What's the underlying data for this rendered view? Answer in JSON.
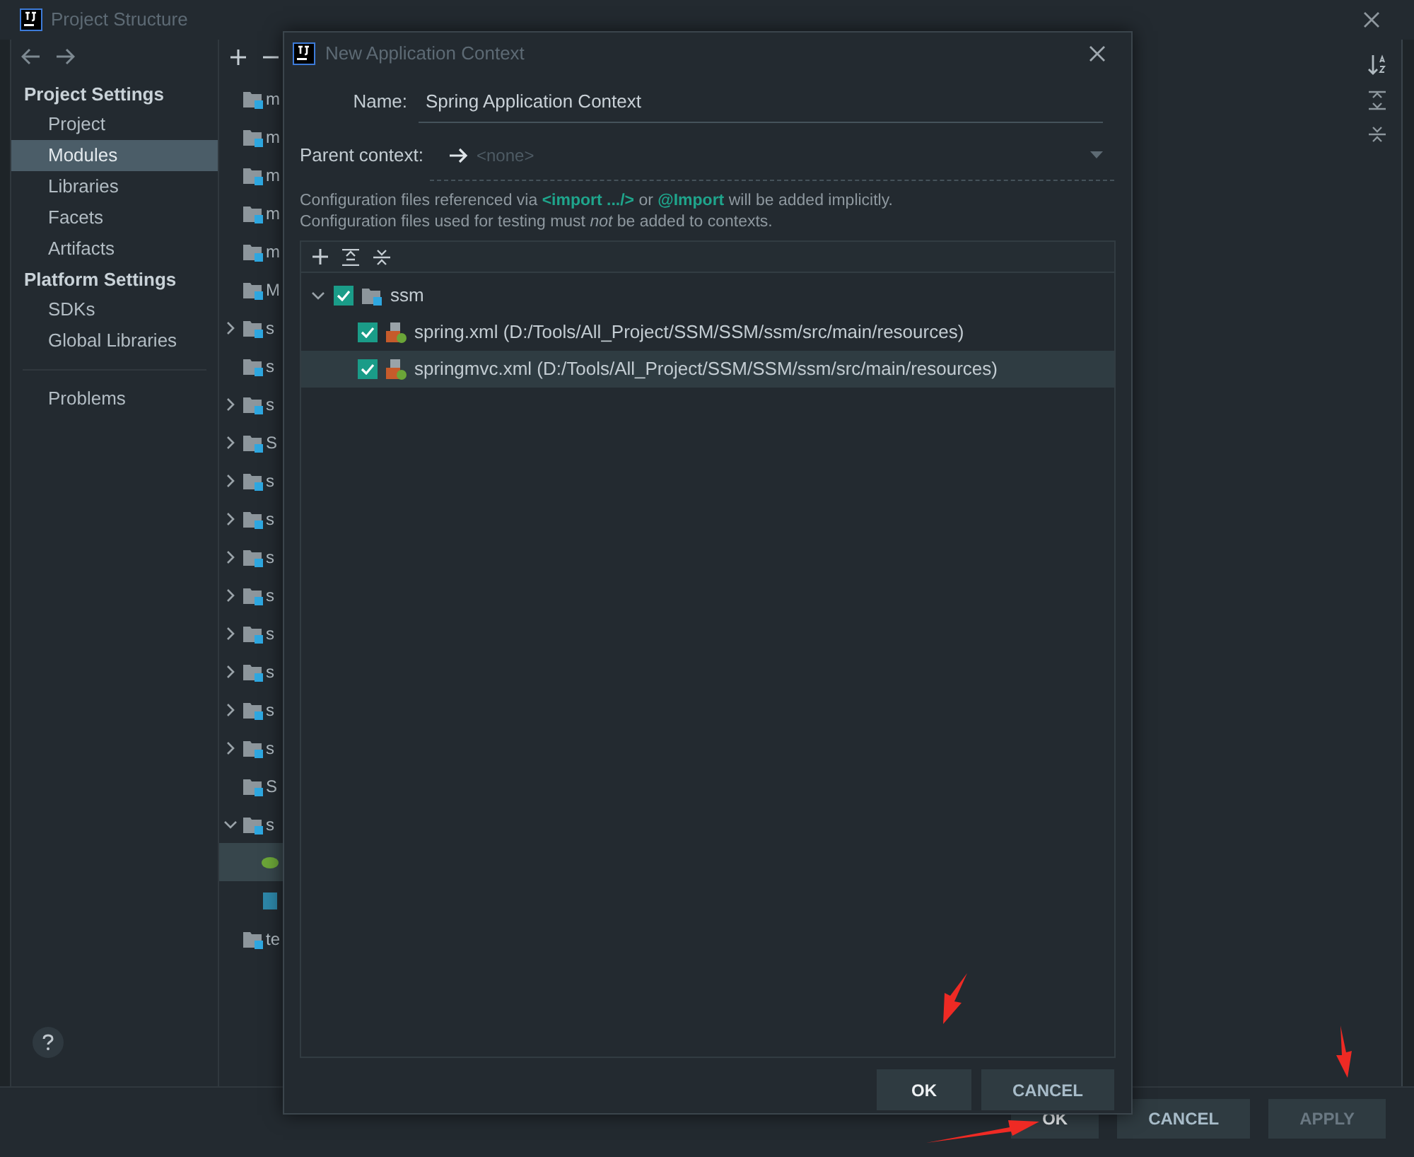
{
  "window": {
    "title": "Project Structure"
  },
  "sidebar": {
    "sections": [
      {
        "title": "Project Settings",
        "items": [
          {
            "label": "Project",
            "selected": false
          },
          {
            "label": "Modules",
            "selected": true
          },
          {
            "label": "Libraries",
            "selected": false
          },
          {
            "label": "Facets",
            "selected": false
          },
          {
            "label": "Artifacts",
            "selected": false
          }
        ]
      },
      {
        "title": "Platform Settings",
        "items": [
          {
            "label": "SDKs",
            "selected": false
          },
          {
            "label": "Global Libraries",
            "selected": false
          }
        ]
      }
    ],
    "problems": {
      "label": "Problems",
      "selected": false
    }
  },
  "modules": {
    "rows": [
      {
        "label": "m",
        "kind": "module",
        "selected": false
      },
      {
        "label": "m",
        "kind": "module",
        "selected": false
      },
      {
        "label": "m",
        "kind": "module",
        "selected": false
      },
      {
        "label": "m",
        "kind": "module",
        "selected": false
      },
      {
        "label": "m",
        "kind": "module",
        "selected": false
      },
      {
        "label": "M",
        "kind": "module",
        "selected": false
      },
      {
        "label": "s",
        "expanded": false,
        "kind": "module",
        "selected": false
      },
      {
        "label": "s",
        "kind": "module",
        "selected": false
      },
      {
        "label": "s",
        "expanded": false,
        "kind": "module",
        "selected": false
      },
      {
        "label": "S",
        "expanded": false,
        "kind": "module",
        "selected": false
      },
      {
        "label": "s",
        "expanded": false,
        "kind": "module",
        "selected": false
      },
      {
        "label": "s",
        "expanded": false,
        "kind": "module",
        "selected": false
      },
      {
        "label": "s",
        "expanded": false,
        "kind": "module",
        "selected": false
      },
      {
        "label": "s",
        "expanded": false,
        "kind": "module",
        "selected": false
      },
      {
        "label": "s",
        "expanded": false,
        "kind": "module",
        "selected": false
      },
      {
        "label": "s",
        "expanded": false,
        "kind": "module",
        "selected": false
      },
      {
        "label": "s",
        "expanded": false,
        "kind": "module",
        "selected": false
      },
      {
        "label": "s",
        "expanded": false,
        "kind": "module",
        "selected": false
      },
      {
        "label": "S",
        "kind": "module",
        "selected": false
      },
      {
        "label": "s",
        "expanded": true,
        "kind": "module",
        "selected": false
      },
      {
        "kind": "spring",
        "selected": true
      },
      {
        "kind": "web",
        "selected": false
      },
      {
        "label": "te",
        "kind": "module",
        "selected": false
      }
    ]
  },
  "buttons": [
    {
      "label": "OK",
      "disabled": false
    },
    {
      "label": "CANCEL",
      "disabled": false
    },
    {
      "label": "APPLY",
      "disabled": true
    }
  ],
  "dialog": {
    "title": "New Application Context",
    "name_label": "Name:",
    "name_value": "Spring Application Context",
    "parent_label": "Parent context:",
    "parent_placeholder": "<none>",
    "notes": [
      "Configuration files referenced via **<import .../>** or **@Import** will be added implicitly.",
      "Configuration files used for testing must *not* be added to contexts."
    ],
    "tree": [
      {
        "label": "ssm",
        "checked": true,
        "expanded": true,
        "selected": false,
        "children": [
          {
            "label": "spring.xml",
            "path": "(D:/Tools/All_Project/SSM/SSM/ssm/src/main/resources)",
            "checked": true,
            "selected": false
          },
          {
            "label": "springmvc.xml",
            "path": "(D:/Tools/All_Project/SSM/SSM/ssm/src/main/resources)",
            "checked": true,
            "selected": true
          }
        ]
      }
    ],
    "buttons": [
      {
        "label": "OK",
        "primary": true
      },
      {
        "label": "CANCEL",
        "primary": false
      }
    ]
  }
}
